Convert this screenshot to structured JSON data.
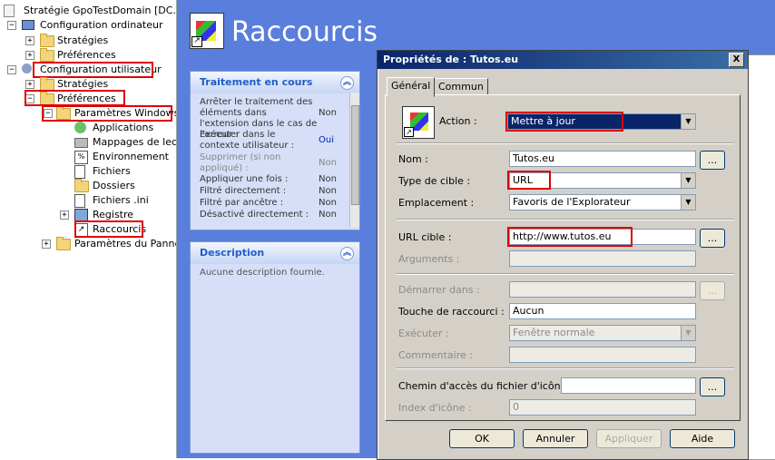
{
  "tree": {
    "root": "Stratégie GpoTestDomain [DC.MYD",
    "computer_config": "Configuration ordinateur",
    "comp_strategies": "Stratégies",
    "comp_preferences": "Préférences",
    "user_config": "Configuration utilisateur",
    "user_strategies": "Stratégies",
    "user_preferences": "Préférences",
    "windows_params": "Paramètres Windows",
    "applications": "Applications",
    "drive_maps": "Mappages de lecte",
    "environment": "Environnement",
    "files": "Fichiers",
    "folders": "Dossiers",
    "ini_files": "Fichiers .ini",
    "registry": "Registre",
    "shortcuts": "Raccourcis",
    "control_panel": "Paramètres du Pannea"
  },
  "main": {
    "title": "Raccourcis",
    "processing_panel": {
      "title": "Traitement en cours",
      "rows": [
        {
          "label": "Arrêter le traitement des éléments dans l'extension dans le cas de l'erreur :",
          "value": "Non"
        },
        {
          "label": "Exécuter dans le contexte utilisateur :",
          "value": "Oui"
        },
        {
          "label": "Supprimer (si non appliqué) :",
          "value": "Non"
        },
        {
          "label": "Appliquer une fois :",
          "value": "Non"
        },
        {
          "label": "Filtré directement :",
          "value": "Non"
        },
        {
          "label": "Filtré par ancêtre :",
          "value": "Non"
        },
        {
          "label": "Désactivé directement :",
          "value": "Non"
        }
      ]
    },
    "description_panel": {
      "title": "Description",
      "text": "Aucune description fournie."
    }
  },
  "dialog": {
    "title": "Propriétés de : Tutos.eu",
    "close": "X",
    "tabs": {
      "general": "Général",
      "common": "Commun"
    },
    "action_label": "Action :",
    "action_value": "Mettre à jour",
    "name_label": "Nom :",
    "name_value": "Tutos.eu",
    "target_type_label": "Type de cible :",
    "target_type_value": "URL",
    "location_label": "Emplacement :",
    "location_value": "Favoris de l'Explorateur",
    "target_url_label": "URL cible :",
    "target_url_value": "http://www.tutos.eu",
    "arguments_label": "Arguments :",
    "start_in_label": "Démarrer dans :",
    "shortcut_key_label": "Touche de raccourci :",
    "shortcut_key_value": "Aucun",
    "run_label": "Exécuter :",
    "run_value": "Fenêtre normale",
    "comment_label": "Commentaire :",
    "icon_path_label": "Chemin d'accès du fichier d'icône :",
    "icon_index_label": "Index d'icône :",
    "icon_index_value": "0",
    "browse": "...",
    "ok": "OK",
    "cancel": "Annuler",
    "apply": "Appliquer",
    "help": "Aide"
  }
}
